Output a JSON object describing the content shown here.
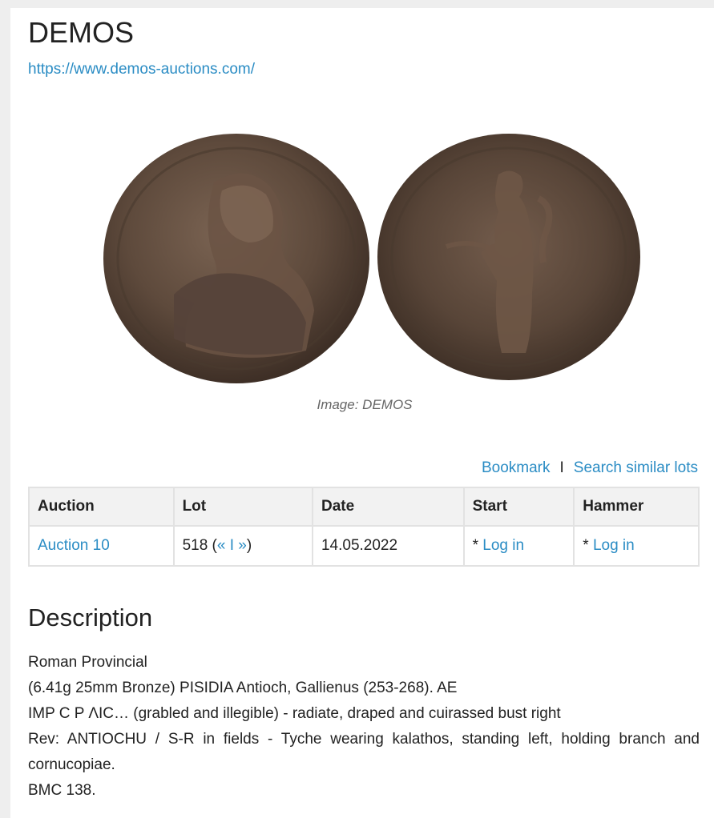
{
  "header": {
    "title": "DEMOS",
    "url": "https://www.demos-auctions.com/"
  },
  "image": {
    "caption": "Image: DEMOS",
    "obverse_legend": "IMP C P ΛIC...",
    "reverse_legend": "ANTIOCHU S-R"
  },
  "actions": {
    "bookmark": "Bookmark",
    "separator": "I",
    "search_similar": "Search similar lots"
  },
  "table": {
    "headers": {
      "auction": "Auction",
      "lot": "Lot",
      "date": "Date",
      "start": "Start",
      "hammer": "Hammer"
    },
    "row": {
      "auction": "Auction 10",
      "lot_number": "518 (",
      "prev": "«",
      "lot_sep": " I ",
      "next": "»",
      "lot_close": ")",
      "date": "14.05.2022",
      "start_prefix": "* ",
      "start_link": "Log in",
      "hammer_prefix": "* ",
      "hammer_link": "Log in"
    }
  },
  "description": {
    "heading": "Description",
    "lines": [
      "Roman Provincial",
      "(6.41g 25mm Bronze) PISIDIA Antioch, Gallienus (253-268). AE",
      "IMP C P ΛIC… (grabled and illegible) - radiate, draped and cuirassed bust right",
      "Rev: ANTIOCHU / S-R in fields - Tyche wearing kalathos, standing left, holding branch and cornucopiae.",
      "BMC 138."
    ]
  },
  "colors": {
    "link": "#2a8cc4",
    "background": "#eeeeee",
    "coin_bronze": "#5e4a3c"
  }
}
